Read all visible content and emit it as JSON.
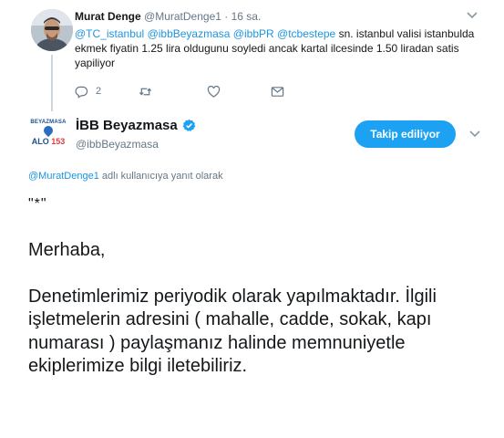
{
  "reply_tweet": {
    "author_name": "Murat Denge",
    "author_handle": "@MuratDenge1",
    "separator": "·",
    "time": "16 sa.",
    "mentions": [
      "@TC_istanbul",
      "@ibbBeyazmasa",
      "@ibbPR",
      "@tcbestepe"
    ],
    "text": "sn. istanbul  valisi istanbulda ekmek fiyatin 1.25 lira oldugunu soyledi ancak kartal ilcesinde 1.50 liradan satis yapiliyor",
    "reply_count": "2",
    "icons": [
      "reply-icon",
      "retweet-icon",
      "like-icon",
      "message-icon"
    ]
  },
  "main_tweet": {
    "author_name": "İBB Beyazmasa",
    "author_handle": "@ibbBeyazmasa",
    "verified": true,
    "logo": {
      "top": "BEYAZMASA",
      "alo": "ALO",
      "number": "153"
    },
    "follow_button": "Takip ediliyor",
    "replying_to_handle": "@MuratDenge1",
    "replying_to_suffix": " adlı kullanıcıya yanıt olarak",
    "quote": "\"*\"",
    "greeting": "Merhaba,",
    "body": "Denetimlerimiz periyodik olarak yapılmaktadır. İlgili işletmelerin adresini ( mahalle, cadde, sokak, kapı numarası ) paylaşmanız halinde memnuniyetle ekiplerimize bilgi iletebiliriz."
  },
  "colors": {
    "accent": "#1da1f2",
    "link": "#1b95e0",
    "muted": "#657786",
    "text": "#14171a",
    "thread_line": "#ccd6dd"
  }
}
